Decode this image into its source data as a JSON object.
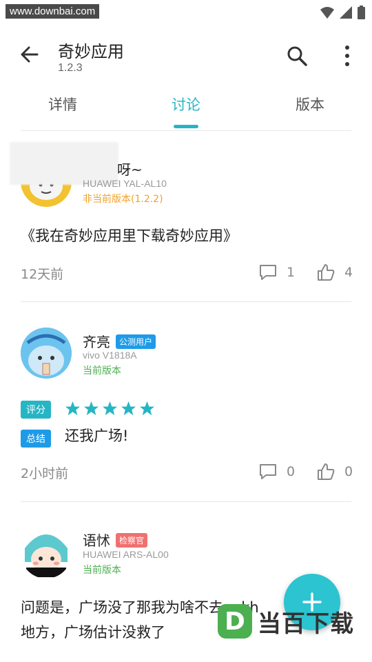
{
  "status_bar": {
    "watermark": "www.downbai.com"
  },
  "app_bar": {
    "title": "奇妙应用",
    "version": "1.2.3"
  },
  "tabs": [
    {
      "label": "详情",
      "active": false
    },
    {
      "label": "讨论",
      "active": true
    },
    {
      "label": "版本",
      "active": false
    }
  ],
  "colors": {
    "accent": "#26b5c4",
    "orange": "#f0a12a",
    "green": "#4caf50",
    "badge_blue": "#1e9be8",
    "badge_red": "#f07070",
    "star": "#26b5c4"
  },
  "posts": [
    {
      "username_fragment": "呀~",
      "device": "HUAWEI YAL-AL10",
      "version_state": "非当前版本(1.2.2)",
      "content": "《我在奇妙应用里下载奇妙应用》",
      "time": "12天前",
      "comments": "1",
      "likes": "4"
    },
    {
      "username": "齐亮",
      "badge": "公测用户",
      "device": "vivo V1818A",
      "version_state": "当前版本",
      "rating_label": "评分",
      "rating": 5,
      "summary_label": "总结",
      "summary": "还我广场!",
      "time": "2小时前",
      "comments": "0",
      "likes": "0"
    },
    {
      "username": "语怵",
      "badge": "检察官",
      "device": "HUAWEI ARS-AL00",
      "version_state": "当前版本",
      "content_line1": "问题是，广场没了那我为啥不去apkh",
      "content_line2": "地方，广场估计没救了"
    }
  ],
  "fab": {
    "icon": "plus-icon"
  },
  "watermark_logo": {
    "letter": "D",
    "text": "当百下载"
  }
}
